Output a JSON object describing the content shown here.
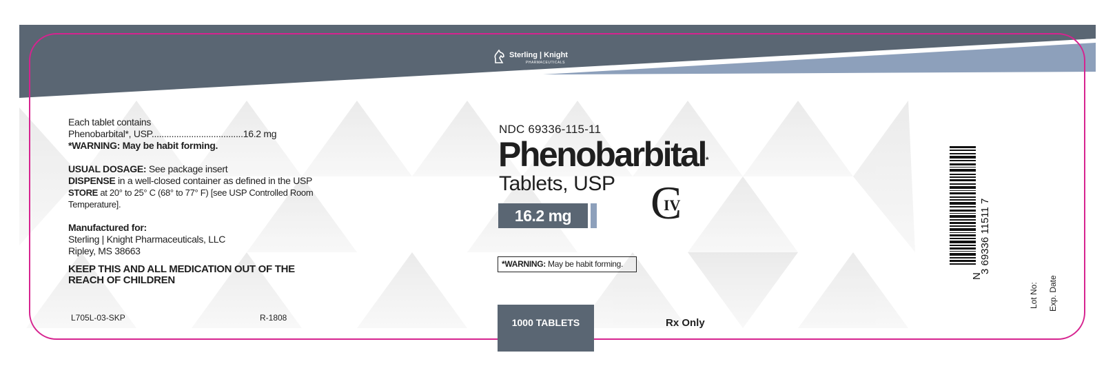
{
  "brand": {
    "name": "Sterling | Knight",
    "subtitle": "PHARMACEUTICALS"
  },
  "left_panel": {
    "contains_line": "Each tablet contains",
    "ingredient_line": "Phenobarbital*, USP.....................................16.2 mg",
    "warning_line": "*WARNING: May be habit forming.",
    "dosage_label": "USUAL DOSAGE:",
    "dosage_text": " See package insert",
    "dispense_label": "DISPENSE",
    "dispense_text": " in a well-closed container as defined in the USP",
    "store_label": "STORE",
    "store_text": " at 20° to 25° C (68°  to 77° F) [see USP Controlled Room",
    "store_text2": "Temperature].",
    "manufactured_label": "Manufactured for:",
    "manufacturer_name": "Sterling | Knight Pharmaceuticals, LLC",
    "manufacturer_city": "Ripley, MS 38663",
    "kids_line1": "KEEP THIS AND ALL MEDICATION OUT OF THE",
    "kids_line2": "REACH OF CHILDREN",
    "code_left": "L705L-03-SKP",
    "code_right": "R-1808"
  },
  "center_panel": {
    "ndc": "NDC 69336-115-11",
    "product_name": "Phenobarbital",
    "product_mark": "*",
    "product_form": "Tablets, USP",
    "strength": "16.2 mg",
    "schedule_letter": "C",
    "schedule_numeral": "IV",
    "warning_label": "*WARNING:",
    "warning_text": " May be habit forming.",
    "count": "1000 TABLETS",
    "rx": "Rx Only"
  },
  "right_panel": {
    "barcode_text": "3 69336 11511 7",
    "barcode_digit_n": "N",
    "lot_label": "Lot No:",
    "exp_label": "Exp. Date"
  },
  "colors": {
    "header_dark": "#5a6673",
    "header_accent": "#8da0bb",
    "dieline": "#d6238f",
    "text": "#1f1f1f"
  }
}
